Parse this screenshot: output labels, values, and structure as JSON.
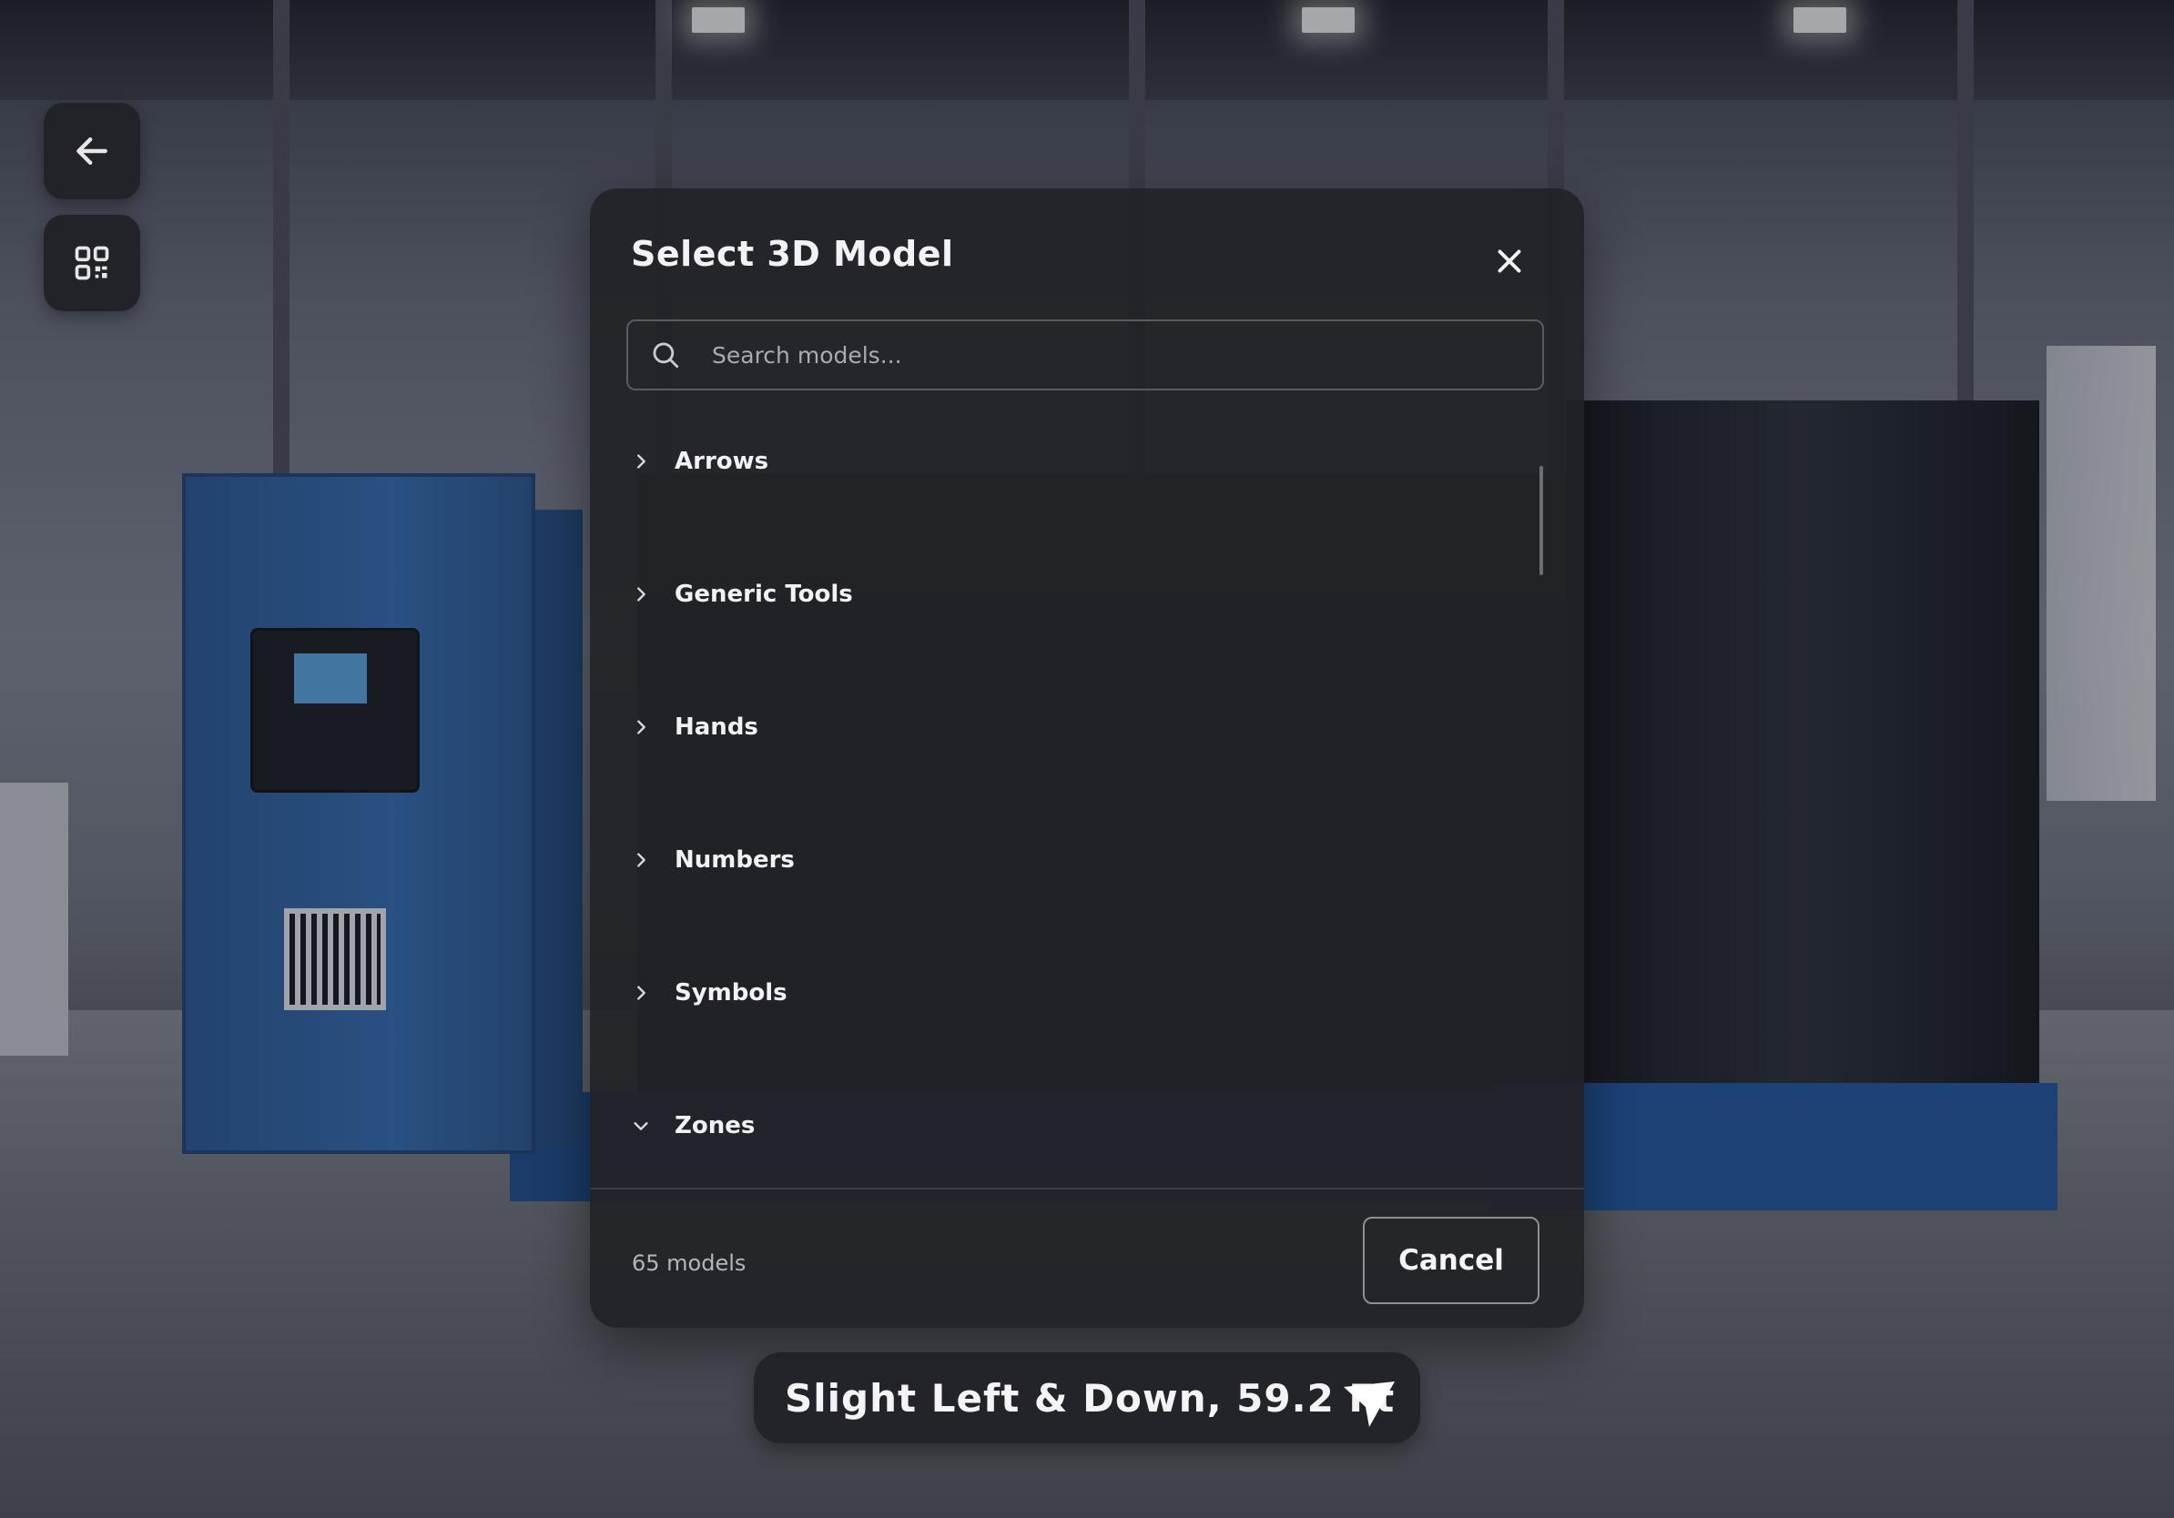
{
  "nav": {
    "back_icon": "arrow-left-icon",
    "qr_icon": "qr-code-icon"
  },
  "modal": {
    "title": "Select 3D Model",
    "close_icon": "close-icon",
    "search": {
      "placeholder": "Search models...",
      "value": "",
      "icon": "search-icon"
    },
    "categories": [
      {
        "label": "Arrows",
        "expanded": false
      },
      {
        "label": "Generic Tools",
        "expanded": false
      },
      {
        "label": "Hands",
        "expanded": false
      },
      {
        "label": "Numbers",
        "expanded": false
      },
      {
        "label": "Symbols",
        "expanded": false
      },
      {
        "label": "Zones",
        "expanded": true
      }
    ],
    "footer": {
      "count_text": "65 models",
      "cancel_label": "Cancel"
    }
  },
  "direction": {
    "text": "Slight Left & Down, 59.2 Ft",
    "icon": "navigation-arrow-icon"
  },
  "colors": {
    "panel_bg": "#222328",
    "text_primary": "#f2f2f4",
    "text_secondary": "#b3b5ba"
  }
}
